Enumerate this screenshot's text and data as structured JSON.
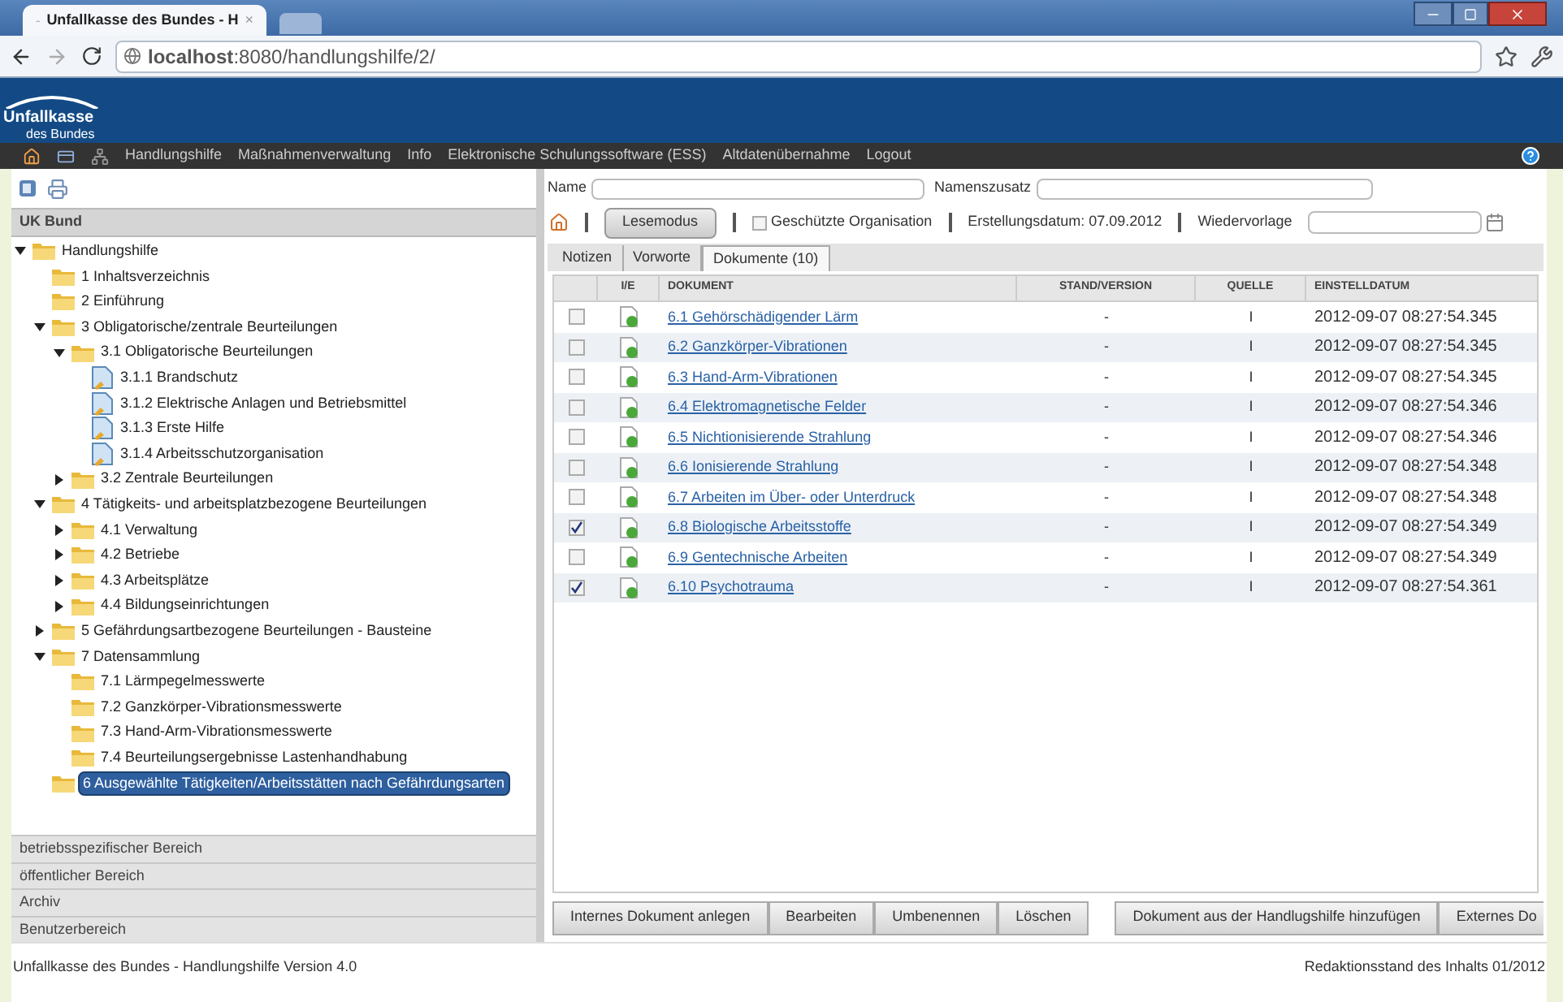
{
  "browser": {
    "tab_title": "Unfallkasse des Bundes - H",
    "tab_close": "×",
    "url": "**localhost**:8080/handlungshilfe/2/"
  },
  "header": {
    "logo_title": "Unfallkasse",
    "logo_subtitle": "des Bundes"
  },
  "nav": {
    "items": [
      "Handlungshilfe",
      "Maßnahmenverwaltung",
      "Info",
      "Elektronische Schulungssoftware (ESS)",
      "Altdatenübernahme",
      "Logout"
    ]
  },
  "sidebar": {
    "title": "UK Bund",
    "tree": [
      {
        "label": "Handlungshilfe",
        "kind": "root",
        "expanded": true,
        "selected": false,
        "children": [
          {
            "label": "1 Inhaltsverzeichnis",
            "kind": "leaf",
            "selected": false
          },
          {
            "label": "2 Einführung",
            "kind": "leaf",
            "selected": false
          },
          {
            "label": "3 Obligatorische/zentrale Beurteilungen",
            "kind": "branch",
            "expanded": true,
            "selected": false,
            "children": [
              {
                "label": "3.1 Obligatorische Beurteilungen",
                "kind": "branch",
                "expanded": true,
                "selected": false,
                "children": [
                  {
                    "label": "3.1.1 Brandschutz",
                    "kind": "document",
                    "selected": false
                  },
                  {
                    "label": "3.1.2 Elektrische Anlagen und Betriebsmittel",
                    "kind": "document",
                    "selected": false
                  },
                  {
                    "label": "3.1.3 Erste Hilfe",
                    "kind": "document",
                    "selected": false
                  },
                  {
                    "label": "3.1.4 Arbeitsschutzorganisation",
                    "kind": "document",
                    "selected": false
                  }
                ]
              },
              {
                "label": "3.2 Zentrale Beurteilungen",
                "kind": "branch",
                "expanded": false,
                "selected": false
              }
            ]
          },
          {
            "label": "4 Tätigkeits- und arbeitsplatzbezogene Beurteilungen",
            "kind": "branch",
            "expanded": true,
            "selected": false,
            "children": [
              {
                "label": "4.1 Verwaltung",
                "kind": "branch",
                "expanded": false,
                "selected": false
              },
              {
                "label": "4.2 Betriebe",
                "kind": "branch",
                "expanded": false,
                "selected": false
              },
              {
                "label": "4.3 Arbeitsplätze",
                "kind": "branch",
                "expanded": false,
                "selected": false
              },
              {
                "label": "4.4 Bildungseinrichtungen",
                "kind": "branch",
                "expanded": false,
                "selected": false
              }
            ]
          },
          {
            "label": "5 Gefährdungsartbezogene Beurteilungen - Bausteine",
            "kind": "branch",
            "expanded": false,
            "selected": false
          },
          {
            "label": "7 Datensammlung",
            "kind": "branch",
            "expanded": true,
            "selected": false,
            "children": [
              {
                "label": "7.1 Lärmpegelmesswerte",
                "kind": "leaf",
                "selected": false
              },
              {
                "label": "7.2 Ganzkörper-Vibrationsmesswerte",
                "kind": "leaf",
                "selected": false
              },
              {
                "label": "7.3 Hand-Arm-Vibrationsmesswerte",
                "kind": "leaf",
                "selected": false
              },
              {
                "label": "7.4 Beurteilungsergebnisse Lastenhandhabung",
                "kind": "leaf",
                "selected": false
              }
            ]
          },
          {
            "label": "6 Ausgewählte Tätigkeiten/Arbeitsstätten nach Gefährdungsarten",
            "kind": "leaf",
            "selected": true
          }
        ]
      }
    ],
    "sections": [
      "betriebsspezifischer Bereich",
      "öffentlicher Bereich",
      "Archiv",
      "Benutzerbereich"
    ]
  },
  "form": {
    "name_label": "Name",
    "suffix_label": "Namenszusatz",
    "mode_button": "Lesemodus",
    "protected_label": "Geschützte Organisation",
    "protected_checked": false,
    "created": "Erstellungsdatum: 07.09.2012",
    "resubmission_label": "Wiedervorlage"
  },
  "tabs": [
    {
      "label": "Notizen",
      "selected": false
    },
    {
      "label": "Vorworte",
      "selected": false
    },
    {
      "label": "Dokumente (10)",
      "selected": true
    }
  ],
  "table": {
    "columns": [
      "I/E",
      "DOKUMENT",
      "STAND/VERSION",
      "QUELLE",
      "EINSTELLDATUM"
    ],
    "rows": [
      {
        "checked": false,
        "document": "6.1 Gehörschädigender Lärm",
        "version": "-",
        "source": "I",
        "date": "2012-09-07 08:27:54.345"
      },
      {
        "checked": false,
        "document": "6.2 Ganzkörper-Vibrationen",
        "version": "-",
        "source": "I",
        "date": "2012-09-07 08:27:54.345"
      },
      {
        "checked": false,
        "document": "6.3 Hand-Arm-Vibrationen",
        "version": "-",
        "source": "I",
        "date": "2012-09-07 08:27:54.345"
      },
      {
        "checked": false,
        "document": "6.4 Elektromagnetische Felder",
        "version": "-",
        "source": "I",
        "date": "2012-09-07 08:27:54.346"
      },
      {
        "checked": false,
        "document": "6.5 Nichtionisierende Strahlung",
        "version": "-",
        "source": "I",
        "date": "2012-09-07 08:27:54.346"
      },
      {
        "checked": false,
        "document": "6.6 Ionisierende Strahlung",
        "version": "-",
        "source": "I",
        "date": "2012-09-07 08:27:54.348"
      },
      {
        "checked": false,
        "document": "6.7 Arbeiten im Über- oder Unterdruck",
        "version": "-",
        "source": "I",
        "date": "2012-09-07 08:27:54.348"
      },
      {
        "checked": true,
        "document": "6.8 Biologische Arbeitsstoffe",
        "version": "-",
        "source": "I",
        "date": "2012-09-07 08:27:54.349"
      },
      {
        "checked": false,
        "document": "6.9 Gentechnische Arbeiten",
        "version": "-",
        "source": "I",
        "date": "2012-09-07 08:27:54.349"
      },
      {
        "checked": true,
        "document": "6.10 Psychotrauma",
        "version": "-",
        "source": "I",
        "date": "2012-09-07 08:27:54.361"
      }
    ]
  },
  "actions_left": [
    "Internes Dokument anlegen",
    "Bearbeiten",
    "Umbenennen",
    "Löschen"
  ],
  "actions_right": [
    "Dokument aus der Handlugshilfe hinzufügen",
    "Externes Do"
  ],
  "footer": {
    "left": "Unfallkasse des Bundes - Handlungshilfe Version 4.0",
    "right": "Redaktionsstand des Inhalts 01/2012"
  }
}
